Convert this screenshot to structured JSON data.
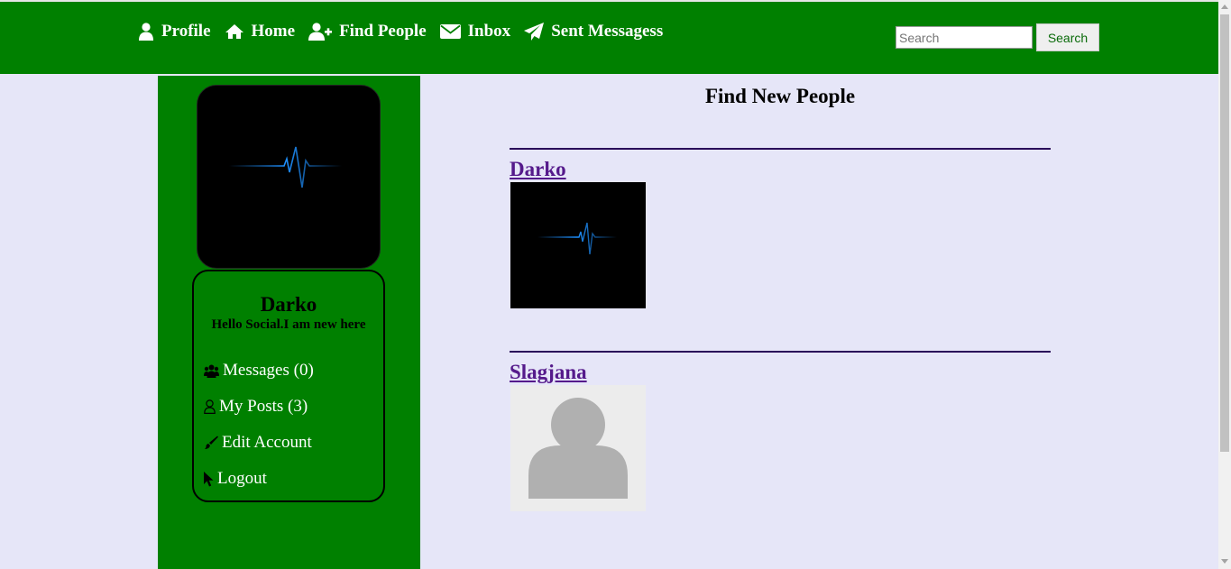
{
  "nav": {
    "items": [
      {
        "label": "Profile",
        "icon": "user-icon"
      },
      {
        "label": "Home",
        "icon": "home-icon"
      },
      {
        "label": "Find People",
        "icon": "user-plus-icon"
      },
      {
        "label": "Inbox",
        "icon": "envelope-icon"
      },
      {
        "label": "Sent Messagess",
        "icon": "paper-plane-icon"
      }
    ],
    "search_placeholder": "Search",
    "search_button": "Search"
  },
  "sidebar": {
    "name": "Darko",
    "bio": "Hello Social.I am new here",
    "menu": [
      {
        "label": "Messages (0)",
        "icon": "users-icon"
      },
      {
        "label": "My Posts (3)",
        "icon": "user-outline-icon"
      },
      {
        "label": "Edit Account",
        "icon": "brush-icon"
      },
      {
        "label": "Logout",
        "icon": "cursor-icon"
      }
    ]
  },
  "main": {
    "title": "Find New People",
    "people": [
      {
        "name": "Darko",
        "image": "heartbeat-image"
      },
      {
        "name": "Slagjana",
        "image": "default-avatar-image"
      }
    ]
  },
  "colors": {
    "nav_green": "#008000",
    "page_bg": "#e6e6f8",
    "link_purple": "#551a8b",
    "heartbeat_blue": "#1e90ff"
  }
}
